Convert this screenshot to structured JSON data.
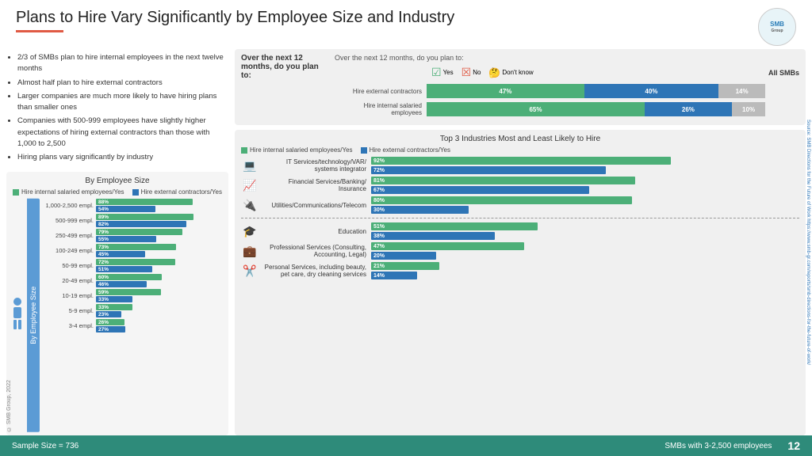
{
  "header": {
    "title": "Plans to Hire Vary Significantly by Employee Size and Industry",
    "logo": "SMB Group"
  },
  "bullets": [
    "2/3 of SMBs plan to hire internal employees in the next twelve months",
    "Almost half plan to hire external contractors",
    "Larger companies are much more likely to have hiring plans than smaller ones",
    "Companies with 500-999 employees have slightly higher expectations of hiring external contractors than those with 1,000 to 2,500",
    "Hiring plans vary significantly by industry"
  ],
  "survey": {
    "title": "Over the  next 12 months, do you plan to:",
    "left_question": "Over the next 12 months, do you plan to:",
    "icons": {
      "yes": "Yes",
      "no": "No",
      "dont_know": "Don't know",
      "all_smbs": "All SMBs"
    },
    "rows": [
      {
        "label": "Hire external contractors",
        "yes_pct": 47,
        "no_pct": 40,
        "dk_pct": 14,
        "yes_label": "47%",
        "no_label": "40%",
        "dk_label": "14%"
      },
      {
        "label": "Hire internal salaried employees",
        "yes_pct": 65,
        "no_pct": 26,
        "dk_pct": 10,
        "yes_label": "65%",
        "no_label": "26%",
        "dk_label": "10%"
      }
    ]
  },
  "emp_chart": {
    "title": "By Employee Size",
    "sidebar_label": "By Employee Size",
    "legend": {
      "green": "Hire internal salaried employees/Yes",
      "blue": "Hire external contractors/Yes"
    },
    "rows": [
      {
        "label": "1,000-2,500 empl.",
        "green": 88,
        "blue": 54,
        "green_label": "88%",
        "blue_label": "54%"
      },
      {
        "label": "500-999 empl.",
        "green": 89,
        "blue": 82,
        "green_label": "89%",
        "blue_label": "82%"
      },
      {
        "label": "250-499 empl.",
        "green": 79,
        "blue": 55,
        "green_label": "79%",
        "blue_label": "55%"
      },
      {
        "label": "100-249 empl.",
        "green": 73,
        "blue": 45,
        "green_label": "73%",
        "blue_label": "45%"
      },
      {
        "label": "50-99 empl.",
        "green": 72,
        "blue": 51,
        "green_label": "72%",
        "blue_label": "51%"
      },
      {
        "label": "20-49 empl.",
        "green": 60,
        "blue": 46,
        "green_label": "60%",
        "blue_label": "46%"
      },
      {
        "label": "10-19 empl.",
        "green": 59,
        "blue": 33,
        "green_label": "59%",
        "blue_label": "33%"
      },
      {
        "label": "5-9 empl.",
        "green": 33,
        "blue": 23,
        "green_label": "33%",
        "blue_label": "23%"
      },
      {
        "label": "3-4 empl.",
        "green": 26,
        "blue": 27,
        "green_label": "26%",
        "blue_label": "27%"
      }
    ]
  },
  "industry_chart": {
    "title": "Top 3 Industries Most and Least Likely to Hire",
    "legend": {
      "green": "Hire internal salaried employees/Yes",
      "blue": "Hire external contractors/Yes"
    },
    "top_rows": [
      {
        "label": "IT Services/technology/VAR/ systems integrator",
        "green": 92,
        "blue": 72,
        "green_label": "92%",
        "blue_label": "72%",
        "icon": "💻"
      },
      {
        "label": "Financial Services/Banking/ Insurance",
        "green": 81,
        "blue": 67,
        "green_label": "81%",
        "blue_label": "67%",
        "icon": "📈"
      },
      {
        "label": "Utilities/Communications/Telecom",
        "green": 80,
        "blue": 30,
        "green_label": "80%",
        "blue_label": "30%",
        "icon": "🔌"
      }
    ],
    "bottom_rows": [
      {
        "label": "Education",
        "green": 51,
        "blue": 38,
        "green_label": "51%",
        "blue_label": "38%",
        "icon": "🎓"
      },
      {
        "label": "Professional Services (Consulting, Accounting, Legal)",
        "green": 47,
        "blue": 20,
        "green_label": "47%",
        "blue_label": "20%",
        "icon": "💼"
      },
      {
        "label": "Personal Services, including beauty, pet care, dry cleaning services",
        "green": 21,
        "blue": 14,
        "green_label": "21%",
        "blue_label": "14%",
        "icon": "✂️"
      }
    ]
  },
  "footer": {
    "sample": "Sample Size = 736",
    "smbs": "SMBs with 3-2,500 employees",
    "page": "12"
  },
  "source": "Source: SMB Directions for the Future of Work\nhttps://www.smb-gr.com/reports/smb-directions-for-the-future-of-work/",
  "copyright": "© SMB Group, 2022"
}
